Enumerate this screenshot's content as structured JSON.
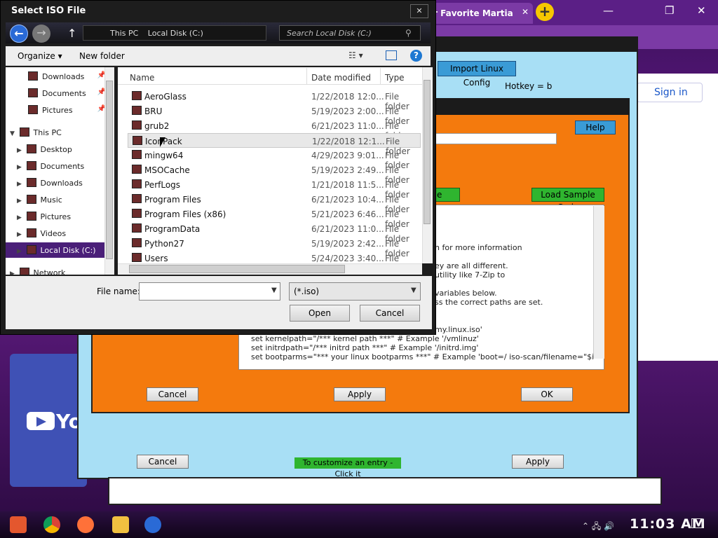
{
  "browser": {
    "tab_title": "r Favorite Martia",
    "tab_close": "✕",
    "new_tab": "+",
    "minimize": "—",
    "restore": "❐",
    "close": "✕",
    "sign_in": "Sign in"
  },
  "youtube": {
    "text": "You"
  },
  "back_window": {
    "import_linux": "Import Linux Config",
    "hotkey": "Hotkey = b",
    "cancel": "Cancel",
    "apply": "Apply",
    "customize": "To customize an entry - Click it"
  },
  "orange_window": {
    "help": "Help",
    "green_left": "e",
    "load_sample": "Load Sample Code",
    "cancel": "Cancel",
    "apply": "Apply",
    "ok": "OK",
    "code_lines": [
      "n for more information",
      "ey are all different.",
      "utility like 7-Zip to",
      "variables below.",
      "ss the correct paths are set.",
      "my.linux.iso'",
      "set kernelpath=\"/***  kernel path ***\"                   # Example '/vmlinuz'",
      "set initrdpath=\"/***  initrd path ***\"                # Example '/initrd.img'",
      "set bootparms=\"***  your linux bootparms ***\"          # Example 'boot=/ iso-scan/filename=\"$isopath\" nonrom"
    ]
  },
  "dialog": {
    "title": "Select ISO File",
    "close": "✕",
    "breadcrumbs": [
      "This PC",
      "Local Disk (C:)"
    ],
    "search_placeholder": "Search Local Disk (C:)",
    "organize": "Organize ▾",
    "new_folder": "New folder",
    "help": "?",
    "nav": [
      {
        "label": "Downloads",
        "pinned": true
      },
      {
        "label": "Documents",
        "pinned": true
      },
      {
        "label": "Pictures",
        "pinned": true
      },
      {
        "label": "This PC"
      },
      {
        "label": "Desktop"
      },
      {
        "label": "Documents"
      },
      {
        "label": "Downloads"
      },
      {
        "label": "Music"
      },
      {
        "label": "Pictures"
      },
      {
        "label": "Videos"
      },
      {
        "label": "Local Disk (C:)",
        "selected": true
      },
      {
        "label": "Network"
      }
    ],
    "columns": {
      "name": "Name",
      "date": "Date modified",
      "type": "Type"
    },
    "files": [
      {
        "name": "AeroGlass",
        "date": "1/22/2018 12:0...",
        "type": "File folder"
      },
      {
        "name": "BRU",
        "date": "5/19/2023 2:00...",
        "type": "File folder"
      },
      {
        "name": "grub2",
        "date": "6/21/2023 11:0...",
        "type": "File folder"
      },
      {
        "name": "IconPack",
        "date": "1/22/2018 12:1...",
        "type": "File folder"
      },
      {
        "name": "mingw64",
        "date": "4/29/2023 9:01...",
        "type": "File folder"
      },
      {
        "name": "MSOCache",
        "date": "5/19/2023 2:49...",
        "type": "File folder"
      },
      {
        "name": "PerfLogs",
        "date": "1/21/2018 11:5...",
        "type": "File folder"
      },
      {
        "name": "Program Files",
        "date": "6/21/2023 10:4...",
        "type": "File folder"
      },
      {
        "name": "Program Files (x86)",
        "date": "5/21/2023 6:46...",
        "type": "File folder"
      },
      {
        "name": "ProgramData",
        "date": "6/21/2023 11:0...",
        "type": "File folder"
      },
      {
        "name": "Python27",
        "date": "5/19/2023 2:42...",
        "type": "File folder"
      },
      {
        "name": "Users",
        "date": "5/24/2023 3:40...",
        "type": "File folder"
      }
    ],
    "file_name_label": "File name:",
    "file_name_value": "",
    "filter": "(*.iso)",
    "open": "Open",
    "cancel": "Cancel"
  },
  "taskbar": {
    "clock": "11:03 AM"
  },
  "colors": {
    "accent": "#4a1f78",
    "orange": "#f47a0d",
    "lightblue": "#a8dff5",
    "green": "#2fb52f"
  }
}
